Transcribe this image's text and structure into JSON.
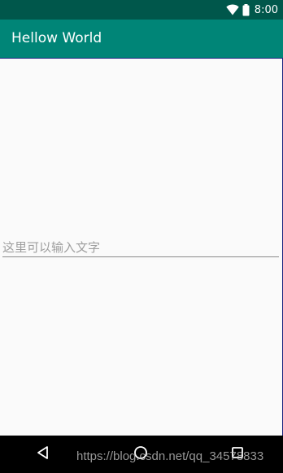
{
  "status_bar": {
    "time": "8:00",
    "icons": [
      "wifi-icon",
      "battery-icon"
    ],
    "background": "#00574b"
  },
  "app_bar": {
    "title": "Hellow World",
    "background": "#008577"
  },
  "main": {
    "input": {
      "value": "",
      "placeholder": "这里可以输入文字"
    }
  },
  "nav_bar": {
    "buttons": [
      "back-icon",
      "home-icon",
      "recents-icon"
    ],
    "background": "#000000"
  },
  "watermark": {
    "text": "https://blog.csdn.net/qq_34578833"
  }
}
